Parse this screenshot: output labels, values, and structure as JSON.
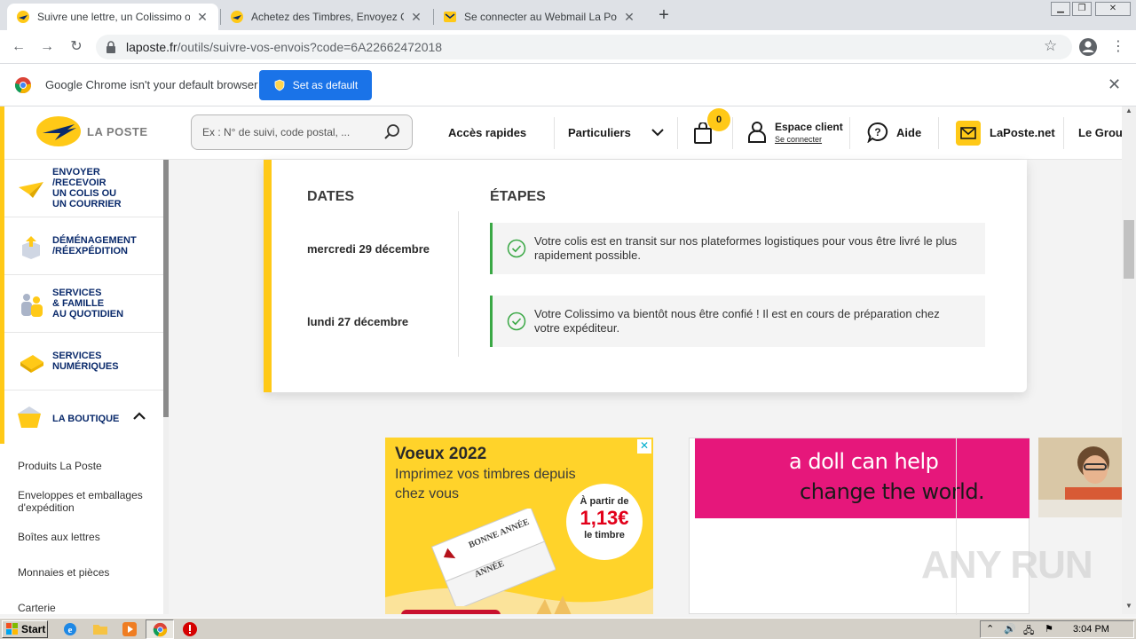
{
  "browser": {
    "tabs": [
      {
        "title": "Suivre une lettre, un Colissimo ou un",
        "active": true
      },
      {
        "title": "Achetez des Timbres, Envoyez Courrie",
        "active": false
      },
      {
        "title": "Se connecter au Webmail La Poste -",
        "active": false
      }
    ],
    "url_host": "laposte.fr",
    "url_path": "/outils/suivre-vos-envois?code=6A22662472018",
    "infobar": {
      "message": "Google Chrome isn't your default browser",
      "button": "Set as default"
    }
  },
  "header": {
    "logo_text": "LA POSTE",
    "search_placeholder": "Ex : N° de suivi, code postal, ...",
    "nav": {
      "acces_rapides": "Accès rapides",
      "particuliers": "Particuliers",
      "cart_count": "0",
      "espace_client": "Espace client",
      "se_connecter": "Se connecter",
      "aide": "Aide",
      "laposte_net": "LaPoste.net",
      "le_groupe": "Le Group"
    }
  },
  "sidebar": {
    "items": [
      {
        "label_lines": [
          "Envoyer",
          "/recevoir",
          "un colis ou",
          "un courrier"
        ]
      },
      {
        "label_lines": [
          "Déménagement",
          "/réexpédition"
        ]
      },
      {
        "label_lines": [
          "Services",
          "& famille",
          "au quotidien"
        ]
      },
      {
        "label_lines": [
          "Services",
          "numériques"
        ]
      },
      {
        "label_lines": [
          "La boutique"
        ]
      }
    ],
    "sublinks": [
      "Produits La Poste",
      "Enveloppes et emballages d'expédition",
      "Boîtes aux lettres",
      "Monnaies et pièces",
      "Carterie"
    ]
  },
  "tracking": {
    "col_dates": "DATES",
    "col_steps": "ÉTAPES",
    "events": [
      {
        "date": "mercredi 29 décembre",
        "text": "Votre colis est en transit sur nos plateformes logistiques pour vous être livré le plus rapidement possible."
      },
      {
        "date": "lundi 27 décembre",
        "text": "Votre Colissimo va bientôt nous être confié ! Il est en cours de préparation chez votre expéditeur."
      }
    ]
  },
  "ads": {
    "voeux": {
      "title": "Voeux 2022",
      "subtitle": "Imprimez vos timbres depuis chez vous",
      "price_prefix": "À partir de",
      "price": "1,13€",
      "price_suffix": "le timbre",
      "ticket_text_1": "BONNE ANNÉE",
      "ticket_text_2": "ANNÉE",
      "close": "✕"
    },
    "doll": {
      "line1": "a doll can help",
      "line2": "change the world."
    }
  },
  "watermark": "ANY RUN",
  "taskbar": {
    "start": "Start",
    "clock": "3:04 PM"
  },
  "colors": {
    "laposte_yellow": "#ffc917",
    "brand_navy": "#0a2a6b",
    "chrome_blue": "#1a73e8",
    "success_green": "#3aa845",
    "ad_pink": "#e6177b"
  }
}
